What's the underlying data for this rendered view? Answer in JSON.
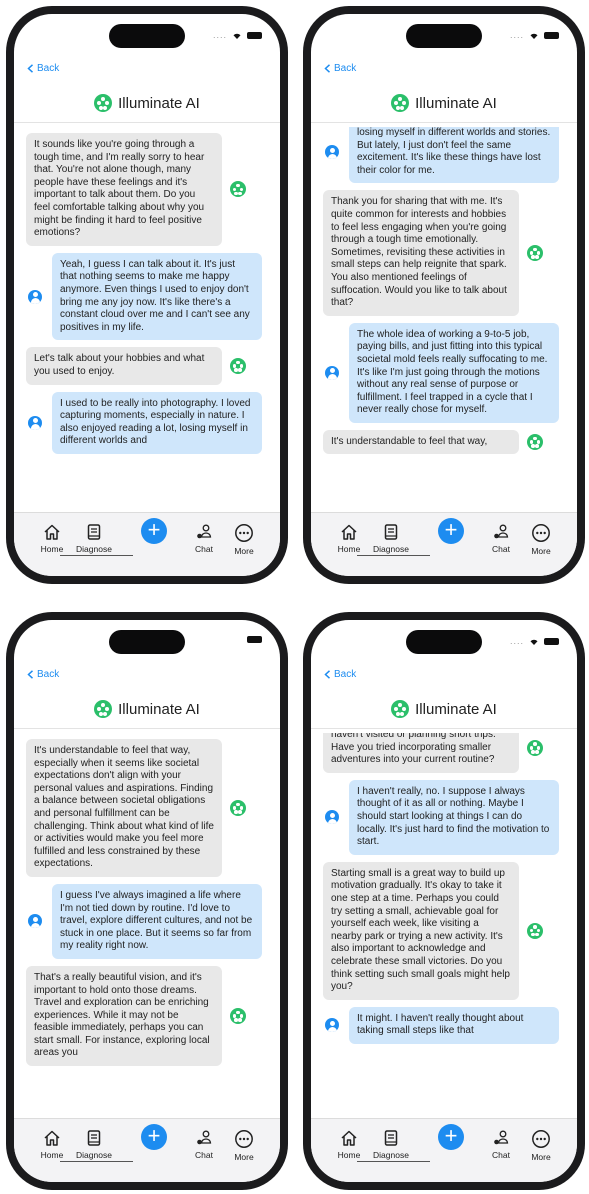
{
  "app": {
    "title": "Illuminate AI",
    "back_label": "Back"
  },
  "tabs": [
    {
      "label": "Home",
      "icon": "home-icon"
    },
    {
      "label": "Diagnose",
      "icon": "book-icon"
    },
    {
      "label": "",
      "icon": "plus-icon"
    },
    {
      "label": "Chat",
      "icon": "chat-users-icon"
    },
    {
      "label": "More",
      "icon": "more-icon"
    }
  ],
  "colors": {
    "accent": "#1d8cf0",
    "brand": "#2bbf6a",
    "ai_bubble": "#e8e8e8",
    "user_bubble": "#cfe6fb"
  },
  "screens": [
    {
      "status": {
        "dots": "....",
        "wifi": true
      },
      "messages": [
        {
          "from": "ai",
          "text": "It sounds like you're going through a tough time, and I'm really sorry to hear that. You're not alone though, many people have these feelings and it's important to talk about them. Do you feel comfortable talking about why you might be finding it hard to feel positive emotions?"
        },
        {
          "from": "user",
          "text": "Yeah, I guess I can talk about it. It's just that nothing seems to make me happy anymore. Even things I used to enjoy don't bring me any joy now. It's like there's a constant cloud over me and I can't see any positives in my life."
        },
        {
          "from": "ai",
          "text": "Let's talk about your hobbies and what you used to enjoy."
        },
        {
          "from": "user",
          "text": "I used to be really into photography. I loved capturing moments, especially in nature. I also enjoyed reading a lot, losing myself in different worlds and"
        }
      ]
    },
    {
      "status": {
        "dots": "....",
        "wifi": true
      },
      "messages": [
        {
          "from": "user",
          "text": "losing myself in different worlds and stories. But lately, I just don't feel the same excitement. It's like these things have lost their color for me."
        },
        {
          "from": "ai",
          "text": "Thank you for sharing that with me. It's quite common for interests and hobbies to feel less engaging when you're going through a tough time emotionally. Sometimes, revisiting these activities in small steps can help reignite that spark. You also mentioned feelings of suffocation. Would you like to talk about that?"
        },
        {
          "from": "user",
          "text": "The whole idea of working a 9-to-5 job, paying bills, and just fitting into this typical societal mold feels really suffocating to me. It's like I'm just going through the motions without any real sense of purpose or fulfillment. I feel trapped in a cycle that I never really chose for myself."
        },
        {
          "from": "ai",
          "text": "It's understandable to feel that way,"
        }
      ]
    },
    {
      "status": {
        "dots": "",
        "wifi": false
      },
      "messages": [
        {
          "from": "ai",
          "text": "It's understandable to feel that way, especially when it seems like societal expectations don't align with your personal values and aspirations. Finding a balance between societal obligations and personal fulfillment can be challenging. Think about what kind of life or activities would make you feel more fulfilled and less constrained by these expectations."
        },
        {
          "from": "user",
          "text": "I guess I've always imagined a life where I'm not tied down by routine. I'd love to travel, explore different cultures, and not be stuck in one place. But it seems so far from my reality right now."
        },
        {
          "from": "ai",
          "text": "That's a really beautiful vision, and it's important to hold onto those dreams. Travel and exploration can be enriching experiences. While it may not be feasible immediately, perhaps you can start small. For instance, exploring local areas you"
        }
      ]
    },
    {
      "status": {
        "dots": "....",
        "wifi": true
      },
      "messages": [
        {
          "from": "ai",
          "text": "haven't visited or planning short trips. Have you tried incorporating smaller adventures into your current routine?"
        },
        {
          "from": "user",
          "text": "I haven't really, no. I suppose I always thought of it as all or nothing. Maybe I should start looking at things I can do locally. It's just hard to find the motivation to start."
        },
        {
          "from": "ai",
          "text": "Starting small is a great way to build up motivation gradually. It's okay to take it one step at a time. Perhaps you could try setting a small, achievable goal for yourself each week, like visiting a nearby park or trying a new activity. It's also important to acknowledge and celebrate these small victories. Do you think setting such small goals might help you?"
        },
        {
          "from": "user",
          "text": "It might. I haven't really thought about taking small steps like that"
        }
      ]
    }
  ]
}
